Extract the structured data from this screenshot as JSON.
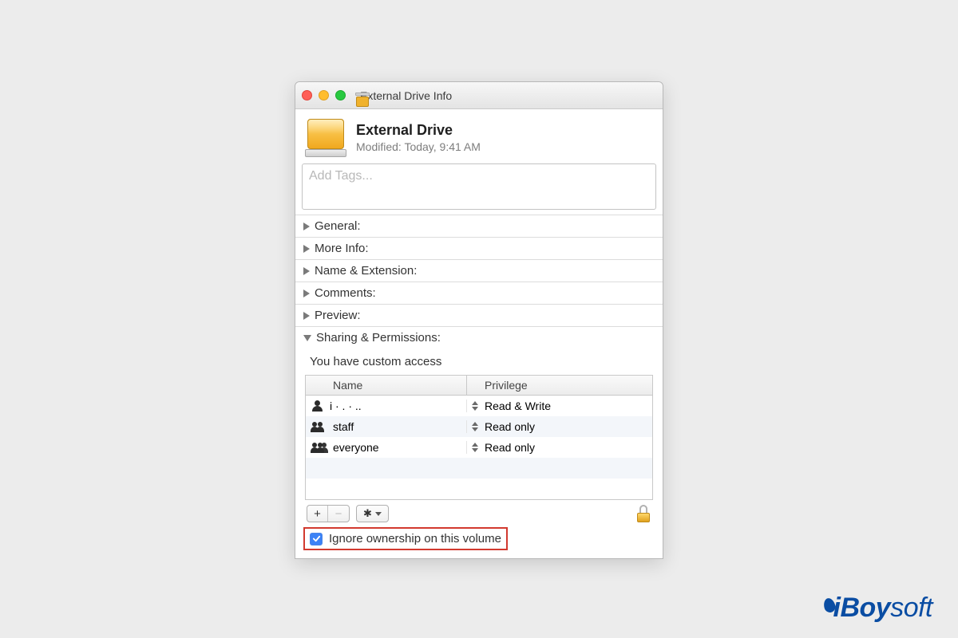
{
  "titlebar": {
    "title": "External Drive Info"
  },
  "header": {
    "name": "External Drive",
    "modified_label": "Modified:",
    "modified_value": "Today, 9:41 AM"
  },
  "tags": {
    "placeholder": "Add Tags..."
  },
  "sections": {
    "general": "General:",
    "more_info": "More Info:",
    "name_ext": "Name & Extension:",
    "comments": "Comments:",
    "preview": "Preview:",
    "sharing": "Sharing & Permissions:"
  },
  "sharing": {
    "access_text": "You have custom access",
    "columns": {
      "name": "Name",
      "privilege": "Privilege"
    },
    "rows": [
      {
        "icon": "user",
        "name": "i ·   . ·       ..",
        "privilege": "Read & Write"
      },
      {
        "icon": "group",
        "name": "staff",
        "privilege": "Read only"
      },
      {
        "icon": "group",
        "name": "everyone",
        "privilege": "Read only"
      }
    ],
    "controls": {
      "add": "+",
      "remove": "−",
      "gear": "⚙"
    },
    "ignore_label": "Ignore ownership on this volume",
    "ignore_checked": true
  },
  "watermark": {
    "brand_i": "i",
    "brand_boy": "Boy",
    "brand_soft": "soft"
  }
}
